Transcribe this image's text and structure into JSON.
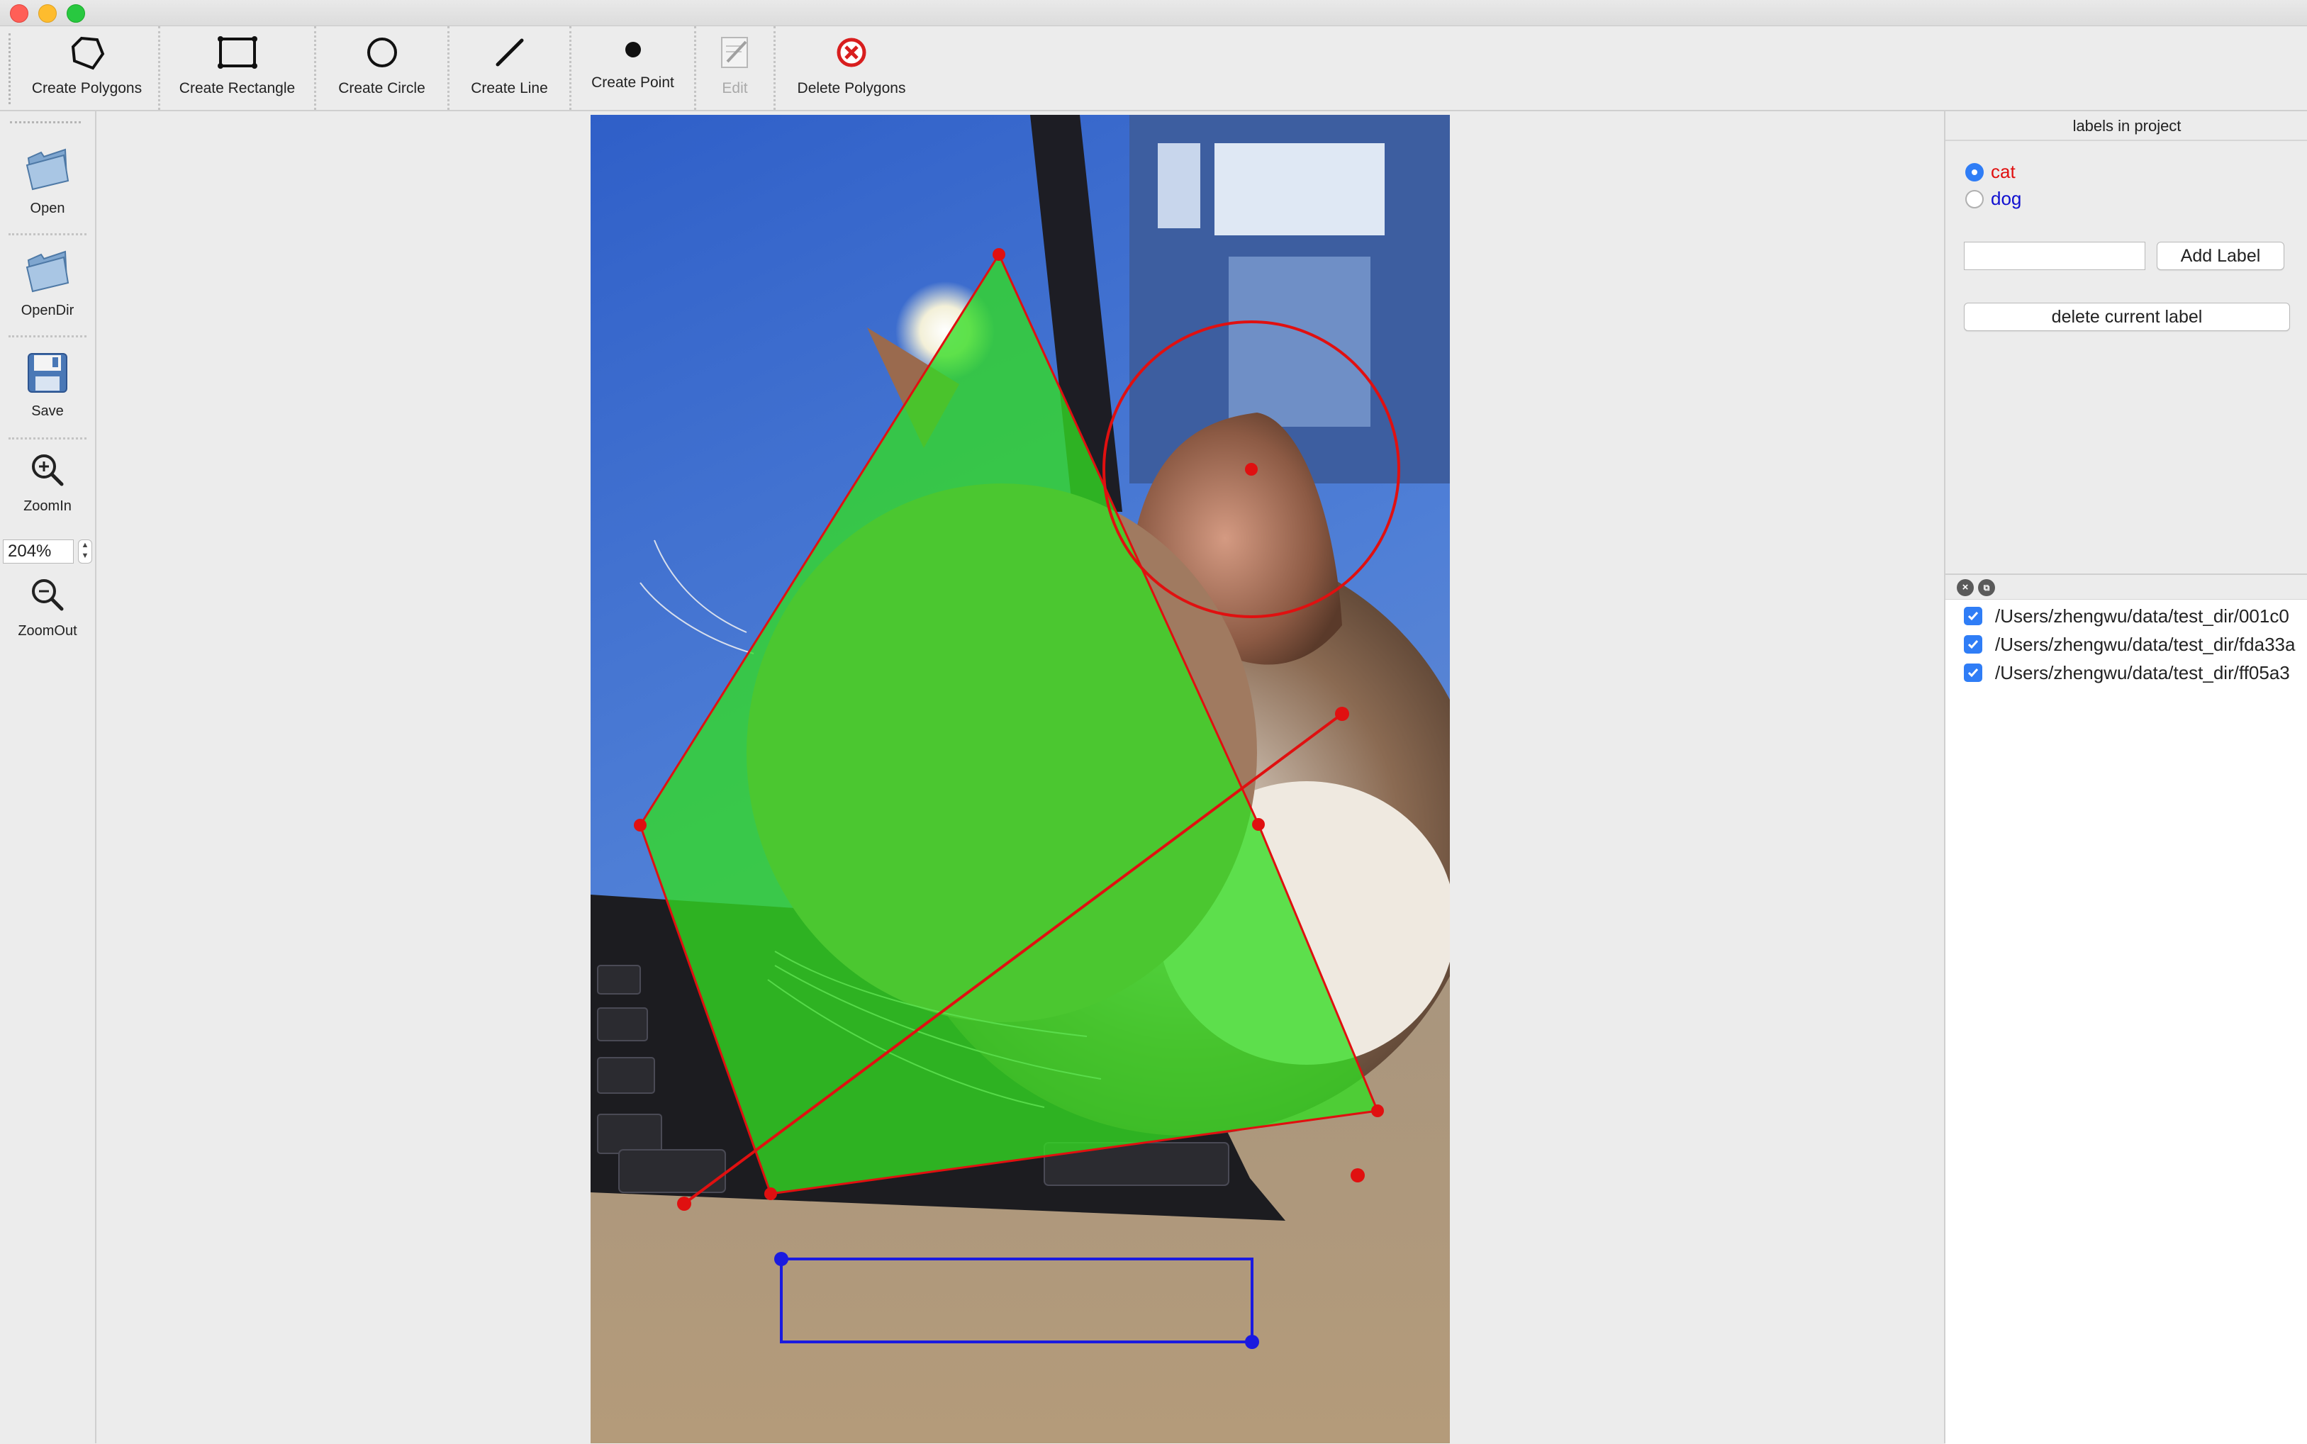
{
  "toolbar": {
    "create_polygons": "Create Polygons",
    "create_rectangle": "Create Rectangle",
    "create_circle": "Create Circle",
    "create_line": "Create Line",
    "create_point": "Create Point",
    "edit": "Edit",
    "delete_polygons": "Delete Polygons"
  },
  "sidebar": {
    "open": "Open",
    "opendir": "OpenDir",
    "save": "Save",
    "zoomin": "ZoomIn",
    "zoom_value": "204%",
    "zoomout": "ZoomOut"
  },
  "labels_panel": {
    "title": "labels in project",
    "labels": [
      {
        "name": "cat",
        "color": "#e01010",
        "selected": true
      },
      {
        "name": "dog",
        "color": "#1010d0",
        "selected": false
      }
    ],
    "new_label_value": "",
    "add_label_button": "Add Label",
    "delete_label_button": "delete current label"
  },
  "files_panel": {
    "files": [
      {
        "path": "/Users/zhengwu/data/test_dir/001c0",
        "checked": true
      },
      {
        "path": "/Users/zhengwu/data/test_dir/fda33a",
        "checked": true
      },
      {
        "path": "/Users/zhengwu/data/test_dir/ff05a3",
        "checked": true
      }
    ]
  },
  "annotations": {
    "polygon_fill": "#33dd22",
    "shape_stroke": "#e01010",
    "rectangle_stroke": "#1a1ae0"
  }
}
